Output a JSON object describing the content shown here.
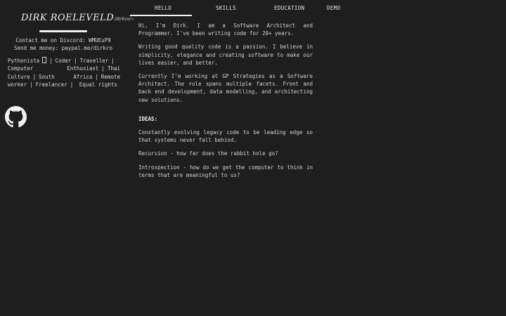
{
  "sidebar": {
    "name": "DIRK ROELEVELD",
    "handle": "/dirkro/~",
    "contact_discord": "Contact me on Discord: WMUEuP9",
    "contact_money": "Send me money: paypal.me/dirkro",
    "tags": {
      "pythonista": "Pythonista",
      "coder": "Coder",
      "traveller": "Traveller",
      "enthusiast": "Computer Enthusiast",
      "thai": "Thai Culture",
      "south_africa": "South Africa",
      "remote": "Remote worker",
      "freelancer": "Freelancer",
      "equal": "Equal rights",
      "separator": "|"
    },
    "github_icon": "github-icon"
  },
  "nav": {
    "tabs": [
      {
        "label": "HELLO",
        "active": true
      },
      {
        "label": "SKILLS",
        "active": false
      },
      {
        "label": "EDUCATION",
        "active": false
      },
      {
        "label": "DEMO",
        "active": false
      }
    ]
  },
  "main": {
    "intro": "Hi, I'm Dirk. I am a Software Architect and Programmer. I've been writing code for 20+ years.",
    "passion": "Writing good quality code is a passion. I believe in simplicity, elegance and creating software to make our lives easier, and better.",
    "current": "Currently I'm working at GP Strategies as a Software Architect. The role spans multiple facets. Front and back end development, data modelling, and architecting new solutions.",
    "ideas_heading": "IDEAS:",
    "ideas": [
      "Constantly evolving legacy code to be leading edge so that systems never fall behind.",
      "Recursion - how far does the rabbit hole go?",
      "Introspection - how do we get the computer to think in terms that are meaningful to us?"
    ]
  },
  "colors": {
    "background": "#1e1e1e",
    "text": "#d8d8d8",
    "accent": "#f2f2f2"
  }
}
